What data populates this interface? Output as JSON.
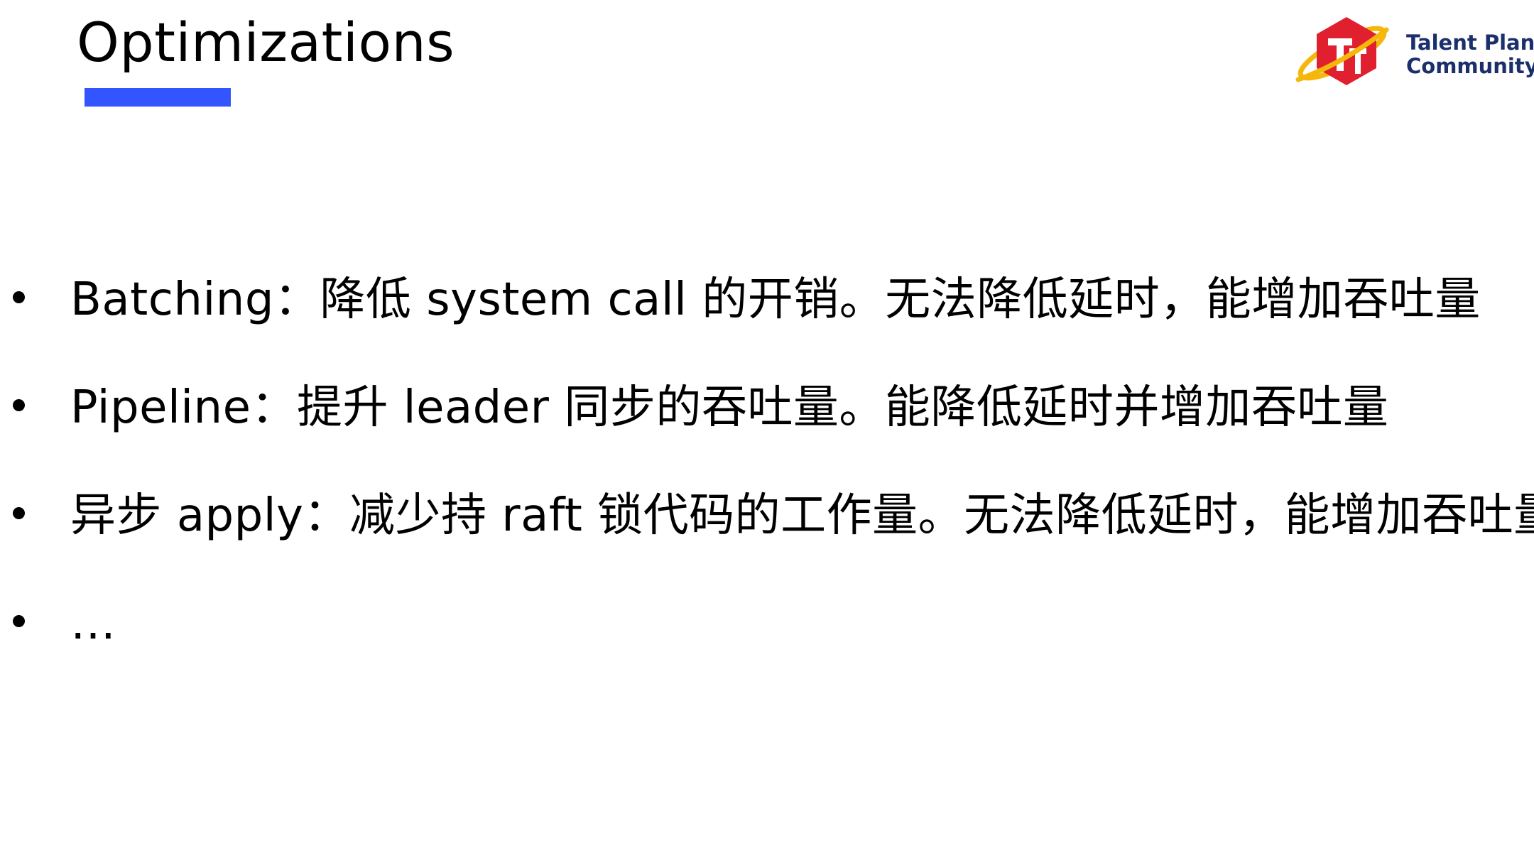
{
  "slide": {
    "title": "Optimizations",
    "accent_color": "#3355ff"
  },
  "logo": {
    "name_line1": "Talent Plan",
    "name_line2": "Community",
    "icon": "tp-hexagon-logo-icon",
    "hex_color": "#e0202e",
    "ring_color": "#f5b80a"
  },
  "bullets": [
    {
      "text": "Batching：降低 system call 的开销。无法降低延时，能增加吞吐量"
    },
    {
      "text": "Pipeline：提升 leader 同步的吞吐量。能降低延时并增加吞吐量"
    },
    {
      "text": "异步 apply：减少持 raft 锁代码的工作量。无法降低延时，能增加吞吐量"
    },
    {
      "text": "…"
    }
  ]
}
